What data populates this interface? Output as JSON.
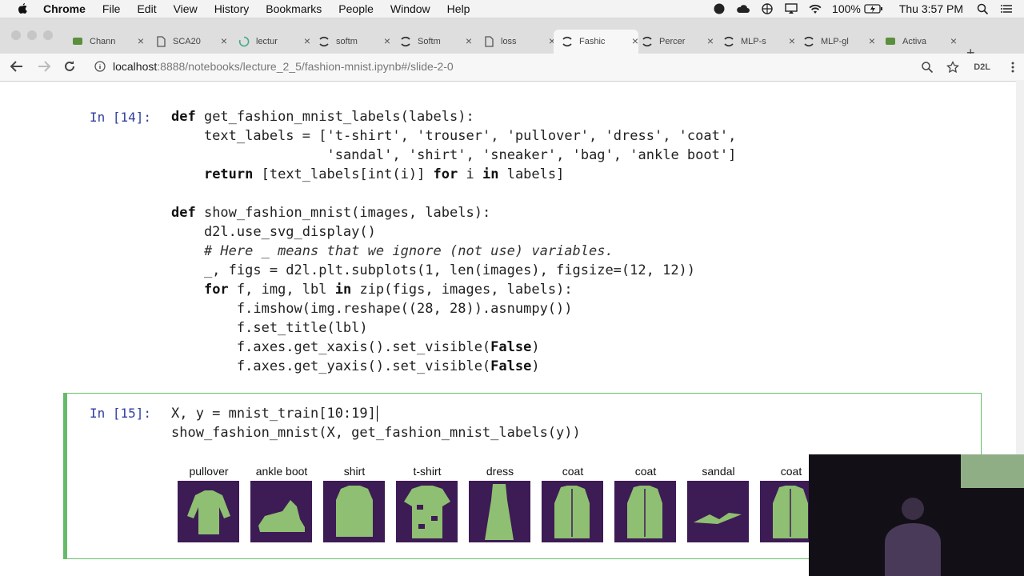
{
  "menubar": {
    "items": [
      "Chrome",
      "File",
      "Edit",
      "View",
      "History",
      "Bookmarks",
      "People",
      "Window",
      "Help"
    ],
    "battery": "100%",
    "clock": "Thu 3:57 PM"
  },
  "tabs": [
    {
      "label": "Chann",
      "icon": "chat-icon"
    },
    {
      "label": "SCA20",
      "icon": "document-icon"
    },
    {
      "label": "lectur",
      "icon": "loading-icon"
    },
    {
      "label": "softm",
      "icon": "jupyter-icon"
    },
    {
      "label": "Softm",
      "icon": "jupyter-icon"
    },
    {
      "label": "loss",
      "icon": "document-icon"
    },
    {
      "label": "Fashic",
      "icon": "jupyter-icon",
      "active": true
    },
    {
      "label": "Percer",
      "icon": "jupyter-icon"
    },
    {
      "label": "MLP-s",
      "icon": "jupyter-icon"
    },
    {
      "label": "MLP-gl",
      "icon": "jupyter-icon"
    },
    {
      "label": "Activa",
      "icon": "chat-icon"
    }
  ],
  "address": {
    "host": "localhost",
    "path": ":8888/notebooks/lecture_2_5/fashion-mnist.ipynb#/slide-2-0",
    "extension_label": "D2L"
  },
  "cell14": {
    "prompt": "In [14]:",
    "lines": [
      [
        [
          "kw",
          "def"
        ],
        [
          "t",
          " get_fashion_mnist_labels(labels):"
        ]
      ],
      [
        [
          "t",
          "    text_labels = ["
        ],
        [
          "str",
          "'t-shirt'"
        ],
        [
          "t",
          ", "
        ],
        [
          "str",
          "'trouser'"
        ],
        [
          "t",
          ", "
        ],
        [
          "str",
          "'pullover'"
        ],
        [
          "t",
          ", "
        ],
        [
          "str",
          "'dress'"
        ],
        [
          "t",
          ", "
        ],
        [
          "str",
          "'coat'"
        ],
        [
          "t",
          ","
        ]
      ],
      [
        [
          "t",
          "                   "
        ],
        [
          "str",
          "'sandal'"
        ],
        [
          "t",
          ", "
        ],
        [
          "str",
          "'shirt'"
        ],
        [
          "t",
          ", "
        ],
        [
          "str",
          "'sneaker'"
        ],
        [
          "t",
          ", "
        ],
        [
          "str",
          "'bag'"
        ],
        [
          "t",
          ", "
        ],
        [
          "str",
          "'ankle boot'"
        ],
        [
          "t",
          "]"
        ]
      ],
      [
        [
          "t",
          "    "
        ],
        [
          "kw",
          "return"
        ],
        [
          "t",
          " [text_labels[int(i)] "
        ],
        [
          "kw",
          "for"
        ],
        [
          "t",
          " i "
        ],
        [
          "kw",
          "in"
        ],
        [
          "t",
          " labels]"
        ]
      ],
      [
        [
          "t",
          ""
        ]
      ],
      [
        [
          "kw",
          "def"
        ],
        [
          "t",
          " show_fashion_mnist(images, labels):"
        ]
      ],
      [
        [
          "t",
          "    d2l.use_svg_display()"
        ]
      ],
      [
        [
          "t",
          "    "
        ],
        [
          "cm",
          "# Here _ means that we ignore (not use) variables."
        ]
      ],
      [
        [
          "t",
          "    _, figs = d2l.plt.subplots(1, len(images), figsize=(12, 12))"
        ]
      ],
      [
        [
          "t",
          "    "
        ],
        [
          "kw",
          "for"
        ],
        [
          "t",
          " f, img, lbl "
        ],
        [
          "kw",
          "in"
        ],
        [
          "t",
          " zip(figs, images, labels):"
        ]
      ],
      [
        [
          "t",
          "        f.imshow(img.reshape((28, 28)).asnumpy())"
        ]
      ],
      [
        [
          "t",
          "        f.set_title(lbl)"
        ]
      ],
      [
        [
          "t",
          "        f.axes.get_xaxis().set_visible("
        ],
        [
          "kw",
          "False"
        ],
        [
          "t",
          ")"
        ]
      ],
      [
        [
          "t",
          "        f.axes.get_yaxis().set_visible("
        ],
        [
          "kw",
          "False"
        ],
        [
          "t",
          ")"
        ]
      ]
    ]
  },
  "cell15": {
    "prompt": "In [15]:",
    "lines": [
      "X, y = mnist_train[10:19]",
      "show_fashion_mnist(X, get_fashion_mnist_labels(y))"
    ],
    "images": [
      {
        "label": "pullover"
      },
      {
        "label": "ankle boot"
      },
      {
        "label": "shirt"
      },
      {
        "label": "t-shirt"
      },
      {
        "label": "dress"
      },
      {
        "label": "coat"
      },
      {
        "label": "coat"
      },
      {
        "label": "sandal"
      },
      {
        "label": "coat"
      }
    ]
  },
  "colors": {
    "prompt": "#303f9f",
    "selected_cell_border": "#66bb6a",
    "thumb_bg": "#3d1b54",
    "thumb_fg": "#8fbf72"
  }
}
